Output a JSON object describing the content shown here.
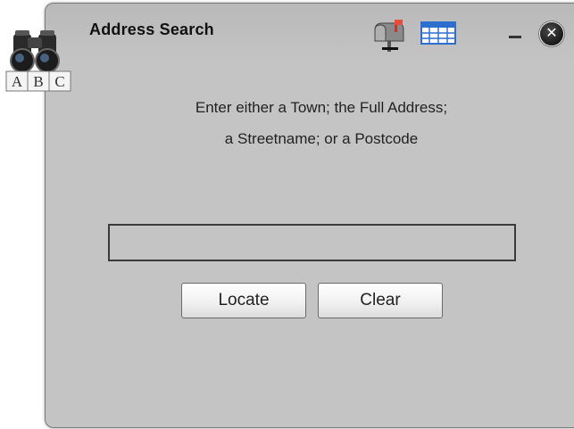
{
  "window": {
    "title": "Address Search",
    "logo_letters": "A B C"
  },
  "instructions": {
    "line1": "Enter either a Town; the Full Address;",
    "line2": "a Streetname; or a Postcode"
  },
  "search": {
    "value": "",
    "placeholder": ""
  },
  "buttons": {
    "locate_label": "Locate",
    "clear_label": "Clear"
  },
  "icons": {
    "logo": "binoculars-abc-icon",
    "mailbox": "mailbox-icon",
    "table": "table-icon",
    "minimize": "minimize-icon",
    "close": "close-icon"
  },
  "colors": {
    "panel_background": "#c4c4c4",
    "input_border": "#3a3a3a",
    "close_button": "#1a1a1a"
  }
}
